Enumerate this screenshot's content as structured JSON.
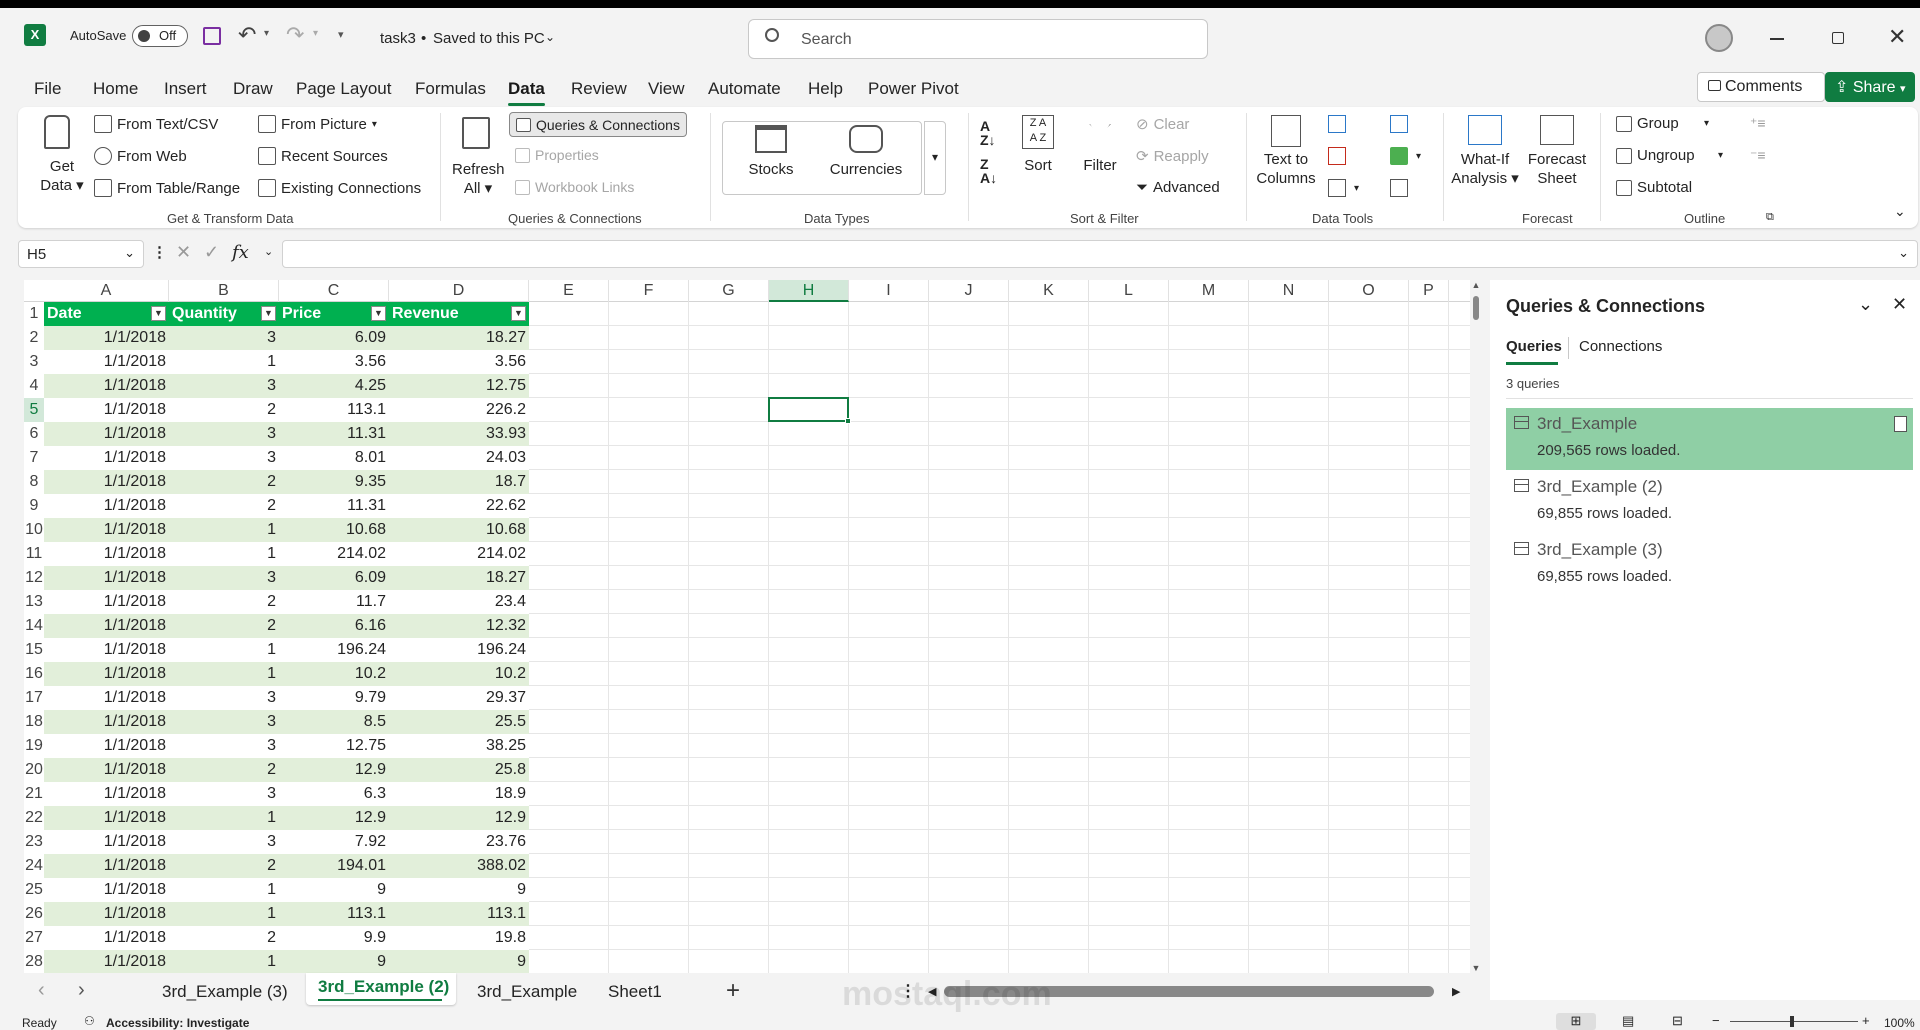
{
  "titlebar": {
    "autosave_label": "AutoSave",
    "autosave_state": "Off",
    "filename": "task3",
    "save_status": "Saved to this PC",
    "search_placeholder": "Search"
  },
  "menu": [
    "File",
    "Home",
    "Insert",
    "Draw",
    "Page Layout",
    "Formulas",
    "Data",
    "Review",
    "View",
    "Automate",
    "Help",
    "Power Pivot"
  ],
  "active_menu": "Data",
  "comments_label": "Comments",
  "share_label": "Share",
  "ribbon": {
    "get_data": "Get",
    "get_data2": "Data",
    "from_text": "From Text/CSV",
    "from_web": "From Web",
    "from_table": "From Table/Range",
    "from_picture": "From Picture",
    "recent_sources": "Recent Sources",
    "existing_connections": "Existing Connections",
    "group_get": "Get & Transform Data",
    "refresh": "Refresh",
    "refresh2": "All",
    "queries_conn": "Queries & Connections",
    "properties": "Properties",
    "workbook_links": "Workbook Links",
    "group_queries": "Queries & Connections",
    "stocks": "Stocks",
    "currencies": "Currencies",
    "group_datatypes": "Data Types",
    "sort": "Sort",
    "filter": "Filter",
    "clear": "Clear",
    "reapply": "Reapply",
    "advanced": "Advanced",
    "group_sort": "Sort & Filter",
    "text_to": "Text to",
    "columns": "Columns",
    "group_tools": "Data Tools",
    "whatif": "What-If",
    "analysis": "Analysis",
    "forecast": "Forecast",
    "sheet": "Sheet",
    "group_forecast": "Forecast",
    "group": "Group",
    "ungroup": "Ungroup",
    "subtotal": "Subtotal",
    "group_outline": "Outline"
  },
  "namebox": "H5",
  "columns": [
    "A",
    "B",
    "C",
    "D",
    "E",
    "F",
    "G",
    "H",
    "I",
    "J",
    "K",
    "L",
    "M",
    "N",
    "O",
    "P"
  ],
  "table_headers": [
    "Date",
    "Quantity",
    "Price",
    "Revenue"
  ],
  "rows": [
    [
      "1/1/2018",
      "3",
      "6.09",
      "18.27"
    ],
    [
      "1/1/2018",
      "1",
      "3.56",
      "3.56"
    ],
    [
      "1/1/2018",
      "3",
      "4.25",
      "12.75"
    ],
    [
      "1/1/2018",
      "2",
      "113.1",
      "226.2"
    ],
    [
      "1/1/2018",
      "3",
      "11.31",
      "33.93"
    ],
    [
      "1/1/2018",
      "3",
      "8.01",
      "24.03"
    ],
    [
      "1/1/2018",
      "2",
      "9.35",
      "18.7"
    ],
    [
      "1/1/2018",
      "2",
      "11.31",
      "22.62"
    ],
    [
      "1/1/2018",
      "1",
      "10.68",
      "10.68"
    ],
    [
      "1/1/2018",
      "1",
      "214.02",
      "214.02"
    ],
    [
      "1/1/2018",
      "3",
      "6.09",
      "18.27"
    ],
    [
      "1/1/2018",
      "2",
      "11.7",
      "23.4"
    ],
    [
      "1/1/2018",
      "2",
      "6.16",
      "12.32"
    ],
    [
      "1/1/2018",
      "1",
      "196.24",
      "196.24"
    ],
    [
      "1/1/2018",
      "1",
      "10.2",
      "10.2"
    ],
    [
      "1/1/2018",
      "3",
      "9.79",
      "29.37"
    ],
    [
      "1/1/2018",
      "3",
      "8.5",
      "25.5"
    ],
    [
      "1/1/2018",
      "3",
      "12.75",
      "38.25"
    ],
    [
      "1/1/2018",
      "2",
      "12.9",
      "25.8"
    ],
    [
      "1/1/2018",
      "3",
      "6.3",
      "18.9"
    ],
    [
      "1/1/2018",
      "1",
      "12.9",
      "12.9"
    ],
    [
      "1/1/2018",
      "3",
      "7.92",
      "23.76"
    ],
    [
      "1/1/2018",
      "2",
      "194.01",
      "388.02"
    ],
    [
      "1/1/2018",
      "1",
      "9",
      "9"
    ],
    [
      "1/1/2018",
      "1",
      "113.1",
      "113.1"
    ],
    [
      "1/1/2018",
      "2",
      "9.9",
      "19.8"
    ],
    [
      "1/1/2018",
      "1",
      "9",
      "9"
    ]
  ],
  "qpane": {
    "title": "Queries & Connections",
    "tab_queries": "Queries",
    "tab_connections": "Connections",
    "count": "3 queries",
    "items": [
      {
        "name": "3rd_Example",
        "rows": "209,565 rows loaded."
      },
      {
        "name": "3rd_Example (2)",
        "rows": "69,855 rows loaded."
      },
      {
        "name": "3rd_Example (3)",
        "rows": "69,855 rows loaded."
      }
    ]
  },
  "sheet_tabs": [
    "3rd_Example (3)",
    "3rd_Example (2)",
    "3rd_Example",
    "Sheet1"
  ],
  "active_tab": "3rd_Example (2)",
  "status": {
    "ready": "Ready",
    "accessibility": "Accessibility: Investigate",
    "zoom": "100%"
  },
  "watermark": "mostaql.com",
  "colors": {
    "accent": "#107c41",
    "table_header": "#00b050",
    "band": "#e2efda",
    "query_selected": "#8fcfa5"
  }
}
